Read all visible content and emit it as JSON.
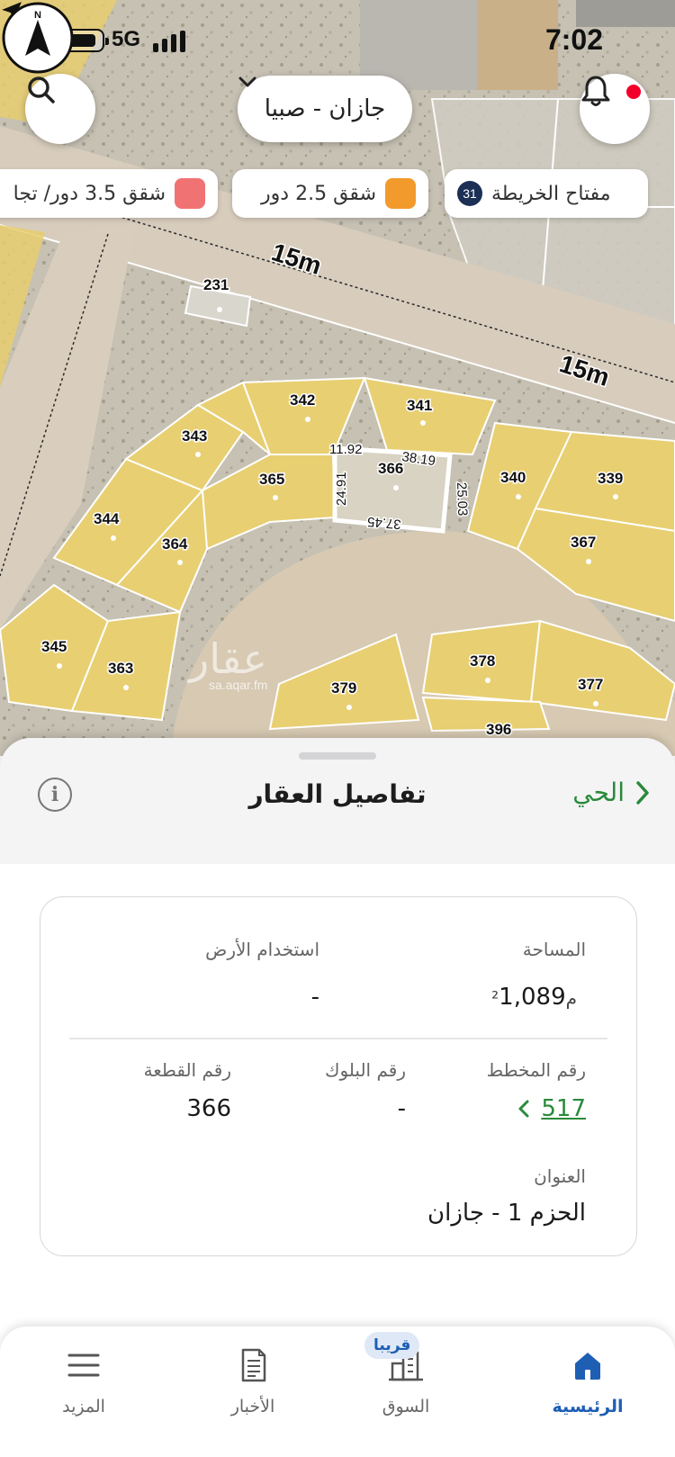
{
  "status_bar": {
    "network": "5G",
    "time": "7:02"
  },
  "map": {
    "city_select": "جازان - صبيا",
    "legend": [
      {
        "label": "مفتاح الخريطة",
        "count": "31"
      },
      {
        "label": "شقق 2.5 دور",
        "color": "#f39a2c"
      },
      {
        "label": "شقق 3.5 دور/ تجا",
        "color": "#f07272"
      }
    ],
    "road_labels": [
      "15m",
      "15m"
    ],
    "compass_letter": "N",
    "watermark": {
      "arabic": "عقار",
      "url": "sa.aqar.fm"
    },
    "plots": [
      "231",
      "342",
      "341",
      "343",
      "365",
      "366",
      "340",
      "339",
      "344",
      "364",
      "367",
      "345",
      "363",
      "379",
      "378",
      "377",
      "396"
    ],
    "dimensions": [
      "11.92",
      "38.19",
      "24.91",
      "25.03",
      "37.45"
    ],
    "selected_plot": "366",
    "colors": {
      "plot_fill": "#e8cf72",
      "plot_selected_border": "#ffffff",
      "road": "#d6cbbb"
    }
  },
  "sheet": {
    "title": "تفاصيل العقار",
    "back_label": "الحي",
    "info_icon": "i",
    "area_label": "المساحة",
    "area_value": "1,089",
    "area_unit": "م²",
    "land_use_label": "استخدام الأرض",
    "land_use_value": "-",
    "plan_label": "رقم المخطط",
    "plan_value": "517",
    "block_label": "رقم البلوك",
    "block_value": "-",
    "plot_label": "رقم القطعة",
    "plot_value": "366",
    "address_label": "العنوان",
    "address_value": "الحزم 1 - جازان"
  },
  "nav": {
    "items": [
      {
        "label": "الرئيسية",
        "icon": "home-icon",
        "active": true
      },
      {
        "label": "السوق",
        "icon": "buildings-icon",
        "active": false
      },
      {
        "label": "الأخبار",
        "icon": "news-icon",
        "active": false
      },
      {
        "label": "المزيد",
        "icon": "menu-icon",
        "active": false
      }
    ],
    "nearby_badge": "قريبا",
    "accent": "#1e5fb3"
  }
}
